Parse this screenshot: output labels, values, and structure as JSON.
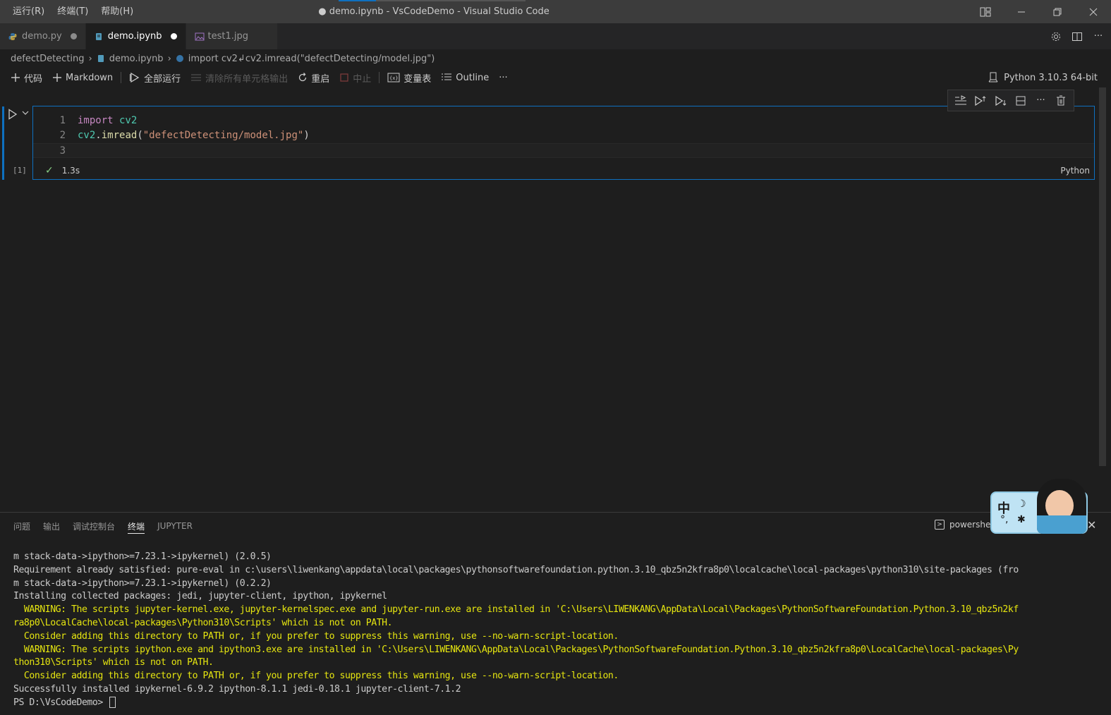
{
  "titlebar": {
    "menus": [
      "运行(R)",
      "终端(T)",
      "帮助(H)"
    ],
    "title": "● demo.ipynb - VsCodeDemo - Visual Studio Code",
    "window_controls": [
      "layout-icon",
      "minimize-icon",
      "restore-icon",
      "close-icon"
    ]
  },
  "tabs": [
    {
      "label": "demo.py",
      "icon": "python-file-icon",
      "dirty": true,
      "active": false
    },
    {
      "label": "demo.ipynb",
      "icon": "notebook-file-icon",
      "dirty": true,
      "active": true
    },
    {
      "label": "test1.jpg",
      "icon": "image-file-icon",
      "dirty": false,
      "active": false
    }
  ],
  "breadcrumb": {
    "folder": "defectDetecting",
    "file": "demo.ipynb",
    "symbol": "import cv2↲cv2.imread(\"defectDetecting/model.jpg\")"
  },
  "toolbar": {
    "add_code": "代码",
    "add_markdown": "Markdown",
    "run_all": "全部运行",
    "clear_outputs": "清除所有单元格输出",
    "restart": "重启",
    "interrupt": "中止",
    "variables": "变量表",
    "outline": "Outline",
    "more": "···",
    "kernel": "Python 3.10.3 64-bit"
  },
  "cell": {
    "execution_count": "[1]",
    "lines": [
      {
        "num": "1",
        "tokens": [
          {
            "t": "import",
            "c": "kw"
          },
          {
            "t": " cv2",
            "c": "mod"
          }
        ]
      },
      {
        "num": "2",
        "tokens": [
          {
            "t": "cv2",
            "c": "mod"
          },
          {
            "t": ".",
            "c": "txt"
          },
          {
            "t": "imread",
            "c": "fn"
          },
          {
            "t": "(",
            "c": "txt"
          },
          {
            "t": "\"defectDetecting/model.jpg\"",
            "c": "str"
          },
          {
            "t": ")",
            "c": "txt"
          }
        ]
      },
      {
        "num": "3",
        "tokens": []
      }
    ],
    "status_time": "1.3s",
    "language": "Python",
    "status_icon": "check-icon"
  },
  "panel": {
    "tabs": [
      "问题",
      "输出",
      "调试控制台",
      "终端",
      "JUPYTER"
    ],
    "active_tab": "终端",
    "shell": "powershell",
    "terminal_lines": [
      {
        "text": "m stack-data->ipython>=7.23.1->ipykernel) (2.0.5)",
        "warn": false
      },
      {
        "text": "Requirement already satisfied: pure-eval in c:\\users\\liwenkang\\appdata\\local\\packages\\pythonsoftwarefoundation.python.3.10_qbz5n2kfra8p0\\localcache\\local-packages\\python310\\site-packages (fro",
        "warn": false
      },
      {
        "text": "m stack-data->ipython>=7.23.1->ipykernel) (0.2.2)",
        "warn": false
      },
      {
        "text": "Installing collected packages: jedi, jupyter-client, ipython, ipykernel",
        "warn": false
      },
      {
        "text": "  WARNING: The scripts jupyter-kernel.exe, jupyter-kernelspec.exe and jupyter-run.exe are installed in 'C:\\Users\\LIWENKANG\\AppData\\Local\\Packages\\PythonSoftwareFoundation.Python.3.10_qbz5n2kf",
        "warn": true
      },
      {
        "text": "ra8p0\\LocalCache\\local-packages\\Python310\\Scripts' which is not on PATH.",
        "warn": true
      },
      {
        "text": "  Consider adding this directory to PATH or, if you prefer to suppress this warning, use --no-warn-script-location.",
        "warn": true
      },
      {
        "text": "  WARNING: The scripts ipython.exe and ipython3.exe are installed in 'C:\\Users\\LIWENKANG\\AppData\\Local\\Packages\\PythonSoftwareFoundation.Python.3.10_qbz5n2kfra8p0\\LocalCache\\local-packages\\Py",
        "warn": true
      },
      {
        "text": "thon310\\Scripts' which is not on PATH.",
        "warn": true
      },
      {
        "text": "  Consider adding this directory to PATH or, if you prefer to suppress this warning, use --no-warn-script-location.",
        "warn": true
      },
      {
        "text": "Successfully installed ipykernel-6.9.2 ipython-8.1.1 jedi-0.18.1 jupyter-client-7.1.2",
        "warn": false
      },
      {
        "text": "PS D:\\VsCodeDemo> ",
        "warn": false,
        "prompt": true
      }
    ]
  },
  "ime": {
    "char": "中",
    "symbols": "°,",
    "moon": "☽",
    "butterfly": "✱"
  },
  "colors": {
    "accent": "#0e70c0",
    "warning_text": "#e5e510",
    "check": "#89d185",
    "keyword": "#c586c0",
    "module": "#4ec9b0",
    "function": "#dcdcaa",
    "string": "#ce9178"
  }
}
